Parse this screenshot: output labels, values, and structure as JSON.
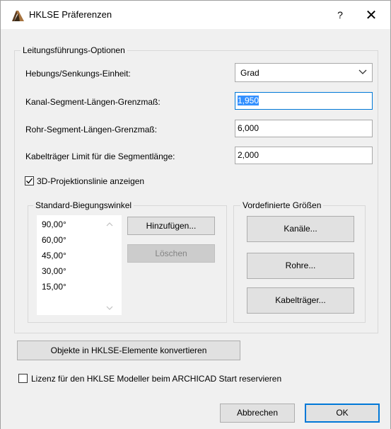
{
  "window": {
    "title": "HKLSE Präferenzen",
    "help_label": "?",
    "close_label": "✕"
  },
  "routing_group": {
    "title": "Leitungsführungs-Optionen",
    "elevation_unit_label": "Hebungs/Senkungs-Einheit:",
    "elevation_unit_value": "Grad",
    "duct_limit_label": "Kanal-Segment-Längen-Grenzmaß:",
    "duct_limit_value": "1,950",
    "pipe_limit_label": "Rohr-Segment-Längen-Grenzmaß:",
    "pipe_limit_value": "6,000",
    "cable_limit_label": "Kabelträger Limit für die Segmentlänge:",
    "cable_limit_value": "2,000",
    "projection_label": "3D-Projektionslinie anzeigen",
    "projection_checked": true
  },
  "bend_group": {
    "title": "Standard-Biegungswinkel",
    "angles": [
      "90,00°",
      "60,00°",
      "45,00°",
      "30,00°",
      "15,00°"
    ],
    "add_label": "Hinzufügen...",
    "delete_label": "Löschen"
  },
  "sizes_group": {
    "title": "Vordefinierte Größen",
    "ducts_label": "Kanäle...",
    "pipes_label": "Rohre...",
    "cable_label": "Kabelträger..."
  },
  "convert_label": "Objekte in HKLSE-Elemente konvertieren",
  "license_label": "Lizenz für den HKLSE Modeller beim ARCHICAD Start reservieren",
  "license_checked": false,
  "footer": {
    "cancel_label": "Abbrechen",
    "ok_label": "OK"
  },
  "colors": {
    "accent": "#0078d7",
    "selection": "#3390ff"
  }
}
